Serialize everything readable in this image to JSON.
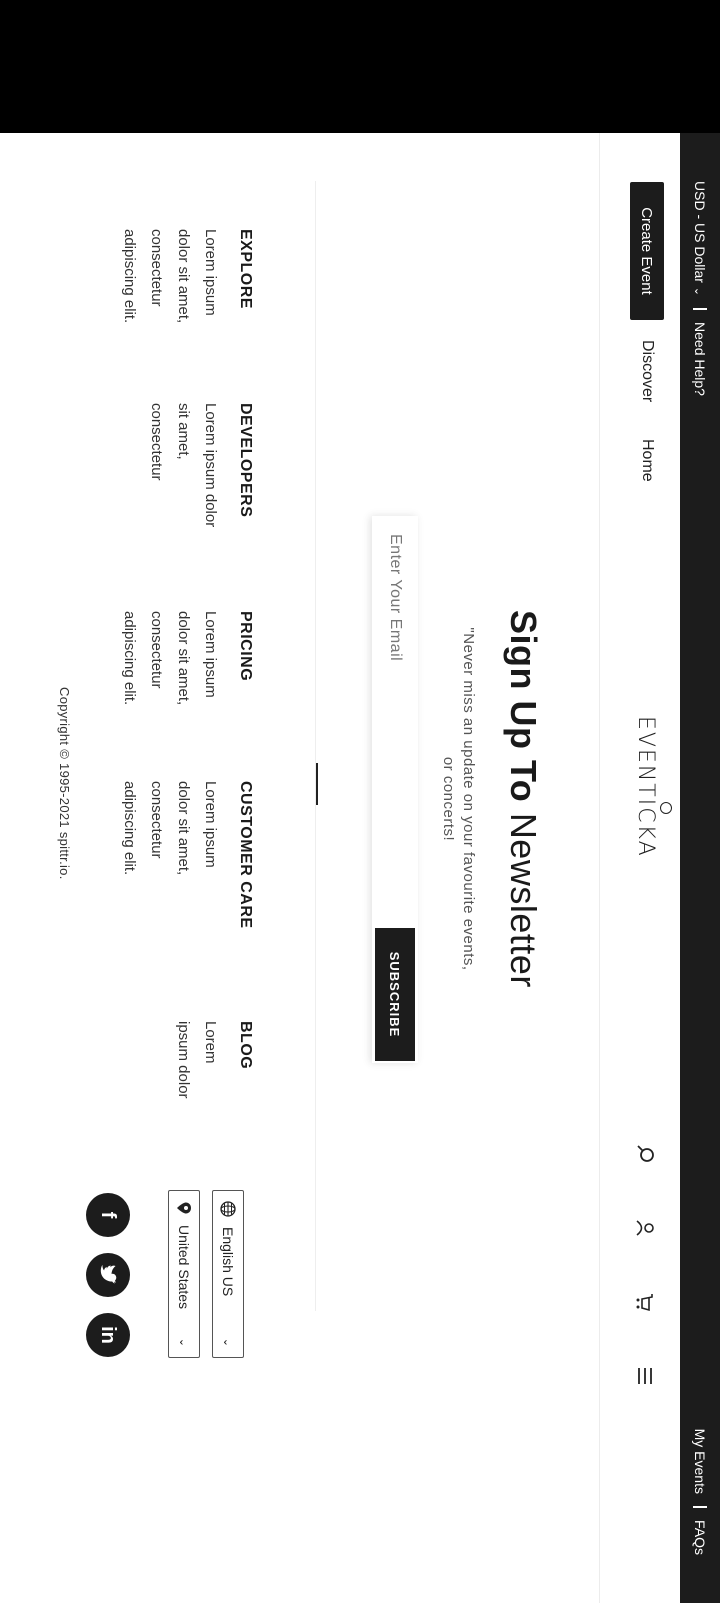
{
  "topbar": {
    "currency": "USD - US Dollar",
    "help": "Need Help?",
    "my_events": "My Events",
    "faqs": "FAQs"
  },
  "nav": {
    "create_event": "Create Event",
    "discover": "Discover",
    "home": "Home",
    "logo_left": "EVENT",
    "logo_pin": "I",
    "logo_right": "CKA"
  },
  "newsletter": {
    "title_bold": "Sign Up To",
    "title_light": "Newsletter",
    "subtitle": "\"Never miss an update on your favourite events, or concerts!",
    "email_placeholder": "Enter Your Email",
    "subscribe": "SUBSCRIBE"
  },
  "footer": {
    "columns": [
      {
        "title": "EXPLORE",
        "lines": [
          "Lorem ipsum",
          "dolor sit amet,",
          "consectetur",
          "adipiscing elit."
        ]
      },
      {
        "title": "DEVELOPERS",
        "lines": [
          "Lorem ipsum dolor",
          "sit amet,",
          "consectetur",
          ""
        ]
      },
      {
        "title": "PRICING",
        "lines": [
          "Lorem ipsum",
          "dolor sit amet,",
          "consectetur",
          "adipiscing elit."
        ]
      },
      {
        "title": "CUSTOMER CARE",
        "lines": [
          "Lorem ipsum",
          "dolor sit amet,",
          "consectetur",
          "adipiscing elit."
        ]
      },
      {
        "title": "BLOG",
        "lines": [
          "Lorem",
          "ipsum dolor",
          "",
          ""
        ]
      }
    ],
    "language": "English US",
    "country": "United States",
    "copyright": "Copyright © 1995-2021 spittr.io."
  },
  "colors": {
    "dark": "#1c1c1c",
    "background": "#ffffff"
  }
}
